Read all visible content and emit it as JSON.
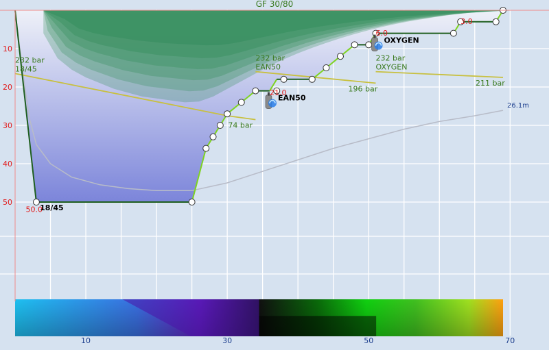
{
  "chart_data": {
    "type": "line",
    "title": "GF 30/80",
    "xlabel": "",
    "ylabel": "",
    "xlim": [
      0,
      75
    ],
    "ylim": [
      0,
      60
    ],
    "x_ticks": [
      "10",
      "30",
      "50",
      "70"
    ],
    "y_ticks": [
      "10",
      "20",
      "30",
      "40",
      "50"
    ],
    "grid": true,
    "dive_profile": {
      "name": "depth",
      "x": [
        0,
        3,
        25,
        27,
        28,
        29,
        30,
        32,
        34,
        36,
        37,
        38,
        42,
        44,
        46,
        48,
        50,
        51,
        52,
        62,
        63,
        68,
        69
      ],
      "y": [
        0,
        50,
        50,
        36,
        33,
        30,
        27,
        24,
        21,
        21,
        18,
        18,
        18,
        15,
        12,
        9,
        9,
        6,
        6,
        6,
        3,
        3,
        0
      ],
      "waypoints": [
        {
          "x": 3,
          "y": 50
        },
        {
          "x": 25,
          "y": 50
        },
        {
          "x": 27,
          "y": 36
        },
        {
          "x": 28,
          "y": 33
        },
        {
          "x": 29,
          "y": 30
        },
        {
          "x": 30,
          "y": 27
        },
        {
          "x": 32,
          "y": 24
        },
        {
          "x": 34,
          "y": 21
        },
        {
          "x": 37,
          "y": 21
        },
        {
          "x": 38,
          "y": 18
        },
        {
          "x": 42,
          "y": 18
        },
        {
          "x": 44,
          "y": 15
        },
        {
          "x": 46,
          "y": 12
        },
        {
          "x": 48,
          "y": 9
        },
        {
          "x": 50,
          "y": 9
        },
        {
          "x": 51,
          "y": 6
        },
        {
          "x": 62,
          "y": 6
        },
        {
          "x": 63,
          "y": 3
        },
        {
          "x": 68,
          "y": 3
        },
        {
          "x": 69,
          "y": 0
        }
      ]
    },
    "ceiling": {
      "x": [
        4,
        6,
        8,
        10,
        12,
        14,
        16,
        18,
        20,
        22,
        24,
        26,
        28,
        30,
        32,
        34,
        36,
        38,
        40,
        42,
        44,
        46,
        48,
        50,
        52,
        54,
        56,
        58,
        60,
        62,
        64,
        66,
        68,
        69
      ],
      "y": [
        6,
        12.5,
        15.5,
        17.5,
        19,
        20.5,
        21.5,
        22.5,
        23,
        23.5,
        24,
        23.8,
        22.5,
        20.5,
        18.5,
        16.5,
        14.5,
        12.8,
        11.2,
        9.8,
        8.5,
        7.3,
        6.2,
        5.2,
        4.3,
        3.5,
        2.8,
        2.2,
        1.6,
        1.1,
        0.7,
        0.4,
        0.1,
        0
      ]
    },
    "deco_stops": [
      {
        "x": 36,
        "y": 21,
        "label": "EAN50"
      },
      {
        "x": 51,
        "y": 6,
        "label": "OXYGEN"
      }
    ],
    "stop_labels": [
      {
        "text": "50.0",
        "x": 1.5,
        "y": 51
      },
      {
        "text": "18/45",
        "x": 3.5,
        "y": 50.5
      },
      {
        "text": "21.0",
        "x": 36,
        "y": 20.5
      },
      {
        "text": "6.0",
        "x": 51,
        "y": 5
      },
      {
        "text": "3.0",
        "x": 63,
        "y": 2
      }
    ],
    "gas_pressure": [
      {
        "name": "18/45",
        "x": [
          0,
          30,
          34
        ],
        "y": [
          16.5,
          27.5,
          28.5
        ],
        "start_label": "232 bar",
        "gas_label": "18/45",
        "end_label": "74 bar",
        "color": "#c8c040"
      },
      {
        "name": "EAN50",
        "x": [
          34,
          51
        ],
        "y": [
          16,
          19
        ],
        "start_label": "232 bar",
        "gas_label": "EAN50",
        "end_label": "196 bar",
        "color": "#c8c040"
      },
      {
        "name": "OXYGEN",
        "x": [
          51,
          69
        ],
        "y": [
          16,
          17.5
        ],
        "start_label": "232 bar",
        "gas_label": "OXYGEN",
        "end_label": "211 bar",
        "color": "#c8c040"
      }
    ],
    "mean_depth": {
      "x": [
        0,
        1,
        2,
        3,
        5,
        8,
        12,
        16,
        20,
        25,
        30,
        35,
        40,
        45,
        50,
        55,
        60,
        65,
        69
      ],
      "y": [
        0,
        15,
        28,
        35,
        40,
        43.5,
        45.5,
        46.5,
        47,
        47,
        45,
        42,
        39,
        36,
        33.5,
        31,
        29,
        27.5,
        26.1
      ],
      "end_label": "26.1m"
    },
    "colors": {
      "background": "#d6e2f0",
      "grid": "#ffffff",
      "depth_fill_top": "#e8ecf6",
      "depth_fill_bottom": "#7f88dc",
      "profile_line": "#1f5f1f",
      "ascent_segment": "#7ed321",
      "ceiling_fill": "#2e8b57",
      "gas_line": "#c8c040",
      "mean_depth_line": "#b8bcc8",
      "axis_x_labels": "#1a3c8c",
      "axis_y_labels": "#e21b1b",
      "title": "#3a7a1f",
      "mean_depth_label": "#1a3c8c"
    }
  }
}
